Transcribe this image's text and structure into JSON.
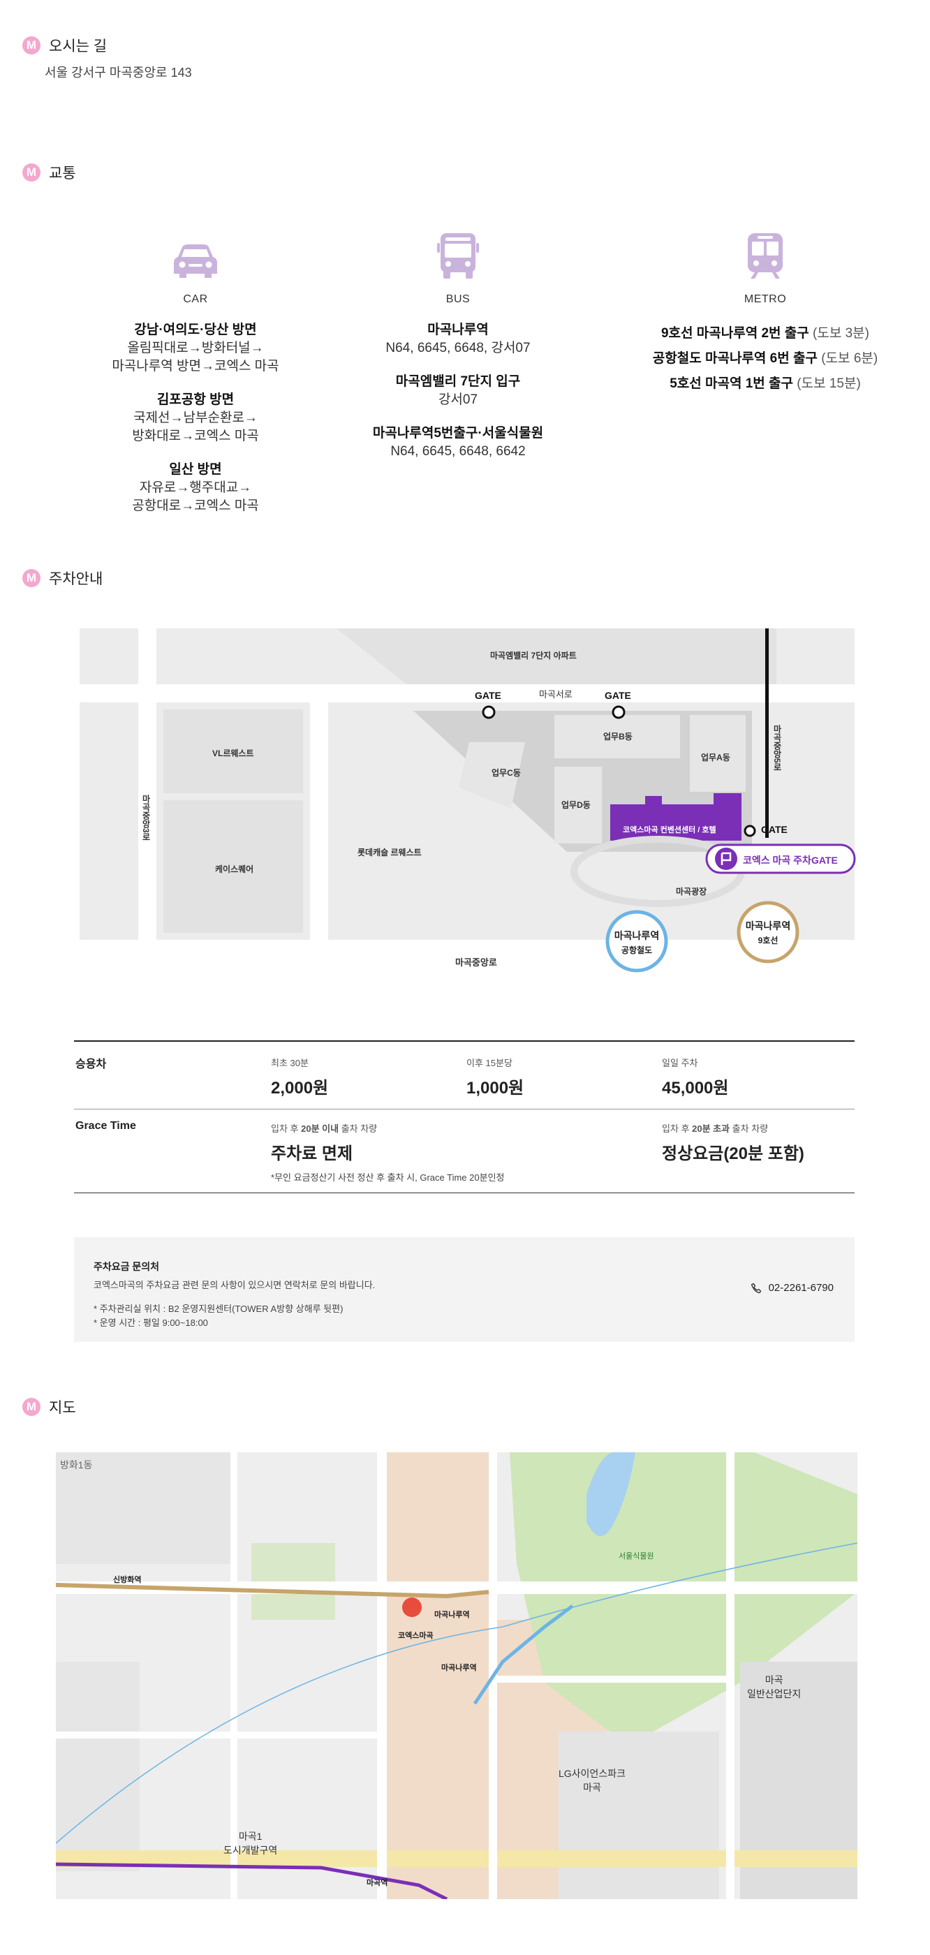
{
  "directions": {
    "badge": "M",
    "title": "오시는 길",
    "address": "서울 강서구 마곡중앙로 143"
  },
  "transport": {
    "badge": "M",
    "title": "교통",
    "car": {
      "label": "CAR",
      "routes": [
        {
          "title": "강남·여의도·당산 방면",
          "lines": [
            "올림픽대로→방화터널→",
            "마곡나루역 방면→코엑스 마곡"
          ]
        },
        {
          "title": "김포공항 방면",
          "lines": [
            "국제선→남부순환로→",
            "방화대로→코엑스 마곡"
          ]
        },
        {
          "title": "일산 방면",
          "lines": [
            "자유로→행주대교→",
            "공항대로→코엑스 마곡"
          ]
        }
      ]
    },
    "bus": {
      "label": "BUS",
      "stops": [
        {
          "title": "마곡나루역",
          "lines": [
            "N64, 6645, 6648, 강서07"
          ]
        },
        {
          "title": "마곡엠밸리 7단지 입구",
          "lines": [
            "강서07"
          ]
        },
        {
          "title": "마곡나루역5번출구·서울식물원",
          "lines": [
            "N64, 6645, 6648, 6642"
          ]
        }
      ]
    },
    "metro": {
      "label": "METRO",
      "lines": [
        {
          "bold": "9호선 마곡나루역 2번 출구",
          "extra": "(도보 3분)"
        },
        {
          "bold": "공항철도 마곡나루역 6번 출구",
          "extra": "(도보 6분)"
        },
        {
          "bold": "5호선 마곡역 1번 출구",
          "extra": "(도보 15분)"
        }
      ]
    }
  },
  "parking": {
    "badge": "M",
    "title": "주차안내",
    "map": {
      "apt7": "마곡엠밸리 7단지 아파트",
      "gate_label": "GATE",
      "magokseoro": "마곡서로",
      "vl": "VL르웨스트",
      "case": "케이스퀘어",
      "lotte": "롯데캐슬 르웨스트",
      "bizB": "업무B동",
      "bizA": "업무A동",
      "bizC": "업무C동",
      "bizD": "업무D동",
      "coex_bldg": "코엑스마곡 컨벤션센터 / 호텔",
      "parking_gate": "코엑스 마곡 주차GATE",
      "plaza": "마곡광장",
      "road_jungang3": "마곡중앙3로",
      "road_jungang5": "마곡중앙5로",
      "road_jungang": "마곡중앙로",
      "station_arex_1": "마곡나루역",
      "station_arex_2": "공항철도",
      "station_l9_1": "마곡나루역",
      "station_l9_2": "9호선",
      "colors": {
        "purple": "#7a2fb6",
        "arex": "#6cb4e4",
        "line9": "#c7a46b"
      }
    },
    "fees": {
      "car_label": "승용차",
      "first_label": "최초 30분",
      "first_value": "2,000원",
      "after_label": "이후 15분당",
      "after_value": "1,000원",
      "daily_label": "일일 주차",
      "daily_value": "45,000원",
      "grace_label": "Grace Time",
      "grace_in_pre": "입차 후 ",
      "grace_in_bold": "20분 이내",
      "grace_in_post": " 출차 차량",
      "grace_in_value": "주차료 면제",
      "grace_note": "*무인 요금정산기 사전 정산 후 출차 시, Grace Time 20분인정",
      "grace_over_pre": "입차 후 ",
      "grace_over_bold": "20분 초과",
      "grace_over_post": " 출차 차량",
      "grace_over_value": "정상요금(20분 포함)"
    },
    "inquiry": {
      "title": "주차요금 문의처",
      "desc": "코엑스마곡의 주차요금 관련 문의 사항이 있으시면 연락처로 문의 바랍니다.",
      "line1": "* 주차관리실 위치 : B2 운영지원센터(TOWER A방향 상해루 뒷편)",
      "line2": "* 운영 시간 : 평일 9:00~18:00",
      "phone": "02-2261-6790"
    }
  },
  "map_section": {
    "badge": "M",
    "title": "지도",
    "labels": {
      "coex": "코엑스마곡",
      "magoknaru": "마곡나루역",
      "magoknaru2": "마곡나루역",
      "balsan": "신방화역",
      "magok": "마곡역",
      "seoul_garden": "서울식물원",
      "lg_science": "LG사이언스파크",
      "lg_science2": "마곡",
      "industrial": "마곡",
      "industrial2": "일반산업단지",
      "dev1": "마곡1",
      "dev2": "도시개발구역",
      "banghwa": "방화1동"
    }
  }
}
